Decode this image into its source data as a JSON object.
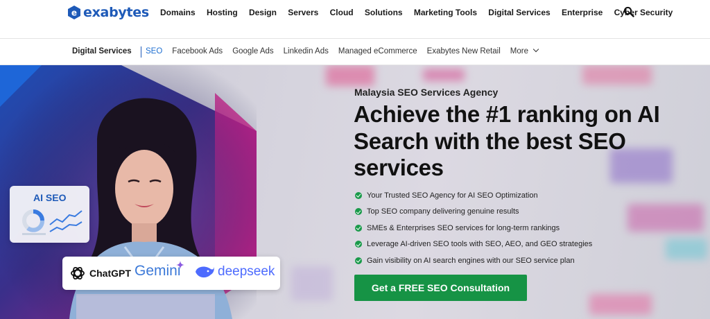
{
  "brand": {
    "name": "exabytes",
    "color": "#1e5ab8"
  },
  "topnav": {
    "items": [
      "Domains",
      "Hosting",
      "Design",
      "Servers",
      "Cloud",
      "Solutions",
      "Marketing Tools",
      "Digital Services",
      "Enterprise",
      "Cyber Security"
    ],
    "search_icon": "search-icon"
  },
  "subnav": {
    "title": "Digital Services",
    "links": [
      "SEO",
      "Facebook Ads",
      "Google Ads",
      "Linkedin Ads",
      "Managed eCommerce",
      "Exabytes New Retail",
      "More"
    ],
    "active": "SEO",
    "more_icon": "chevron-down-icon"
  },
  "hero": {
    "eyebrow": "Malaysia SEO Services Agency",
    "headline": "Achieve the #1 ranking on AI Search with the best SEO services",
    "bullets": [
      "Your Trusted SEO Agency for AI SEO Optimization",
      "Top SEO company delivering genuine results",
      "SMEs & Enterprises SEO services for long-term rankings",
      "Leverage AI-driven SEO tools with SEO, AEO, and GEO strategies",
      "Gain visibility on AI search engines with our SEO service plan"
    ],
    "cta": "Get a FREE SEO Consultation",
    "cta_color": "#169345",
    "ai_card_title": "AI SEO",
    "brands": {
      "chatgpt": "ChatGPT",
      "gemini": "Gemini",
      "deepseek": "deepseek"
    }
  }
}
